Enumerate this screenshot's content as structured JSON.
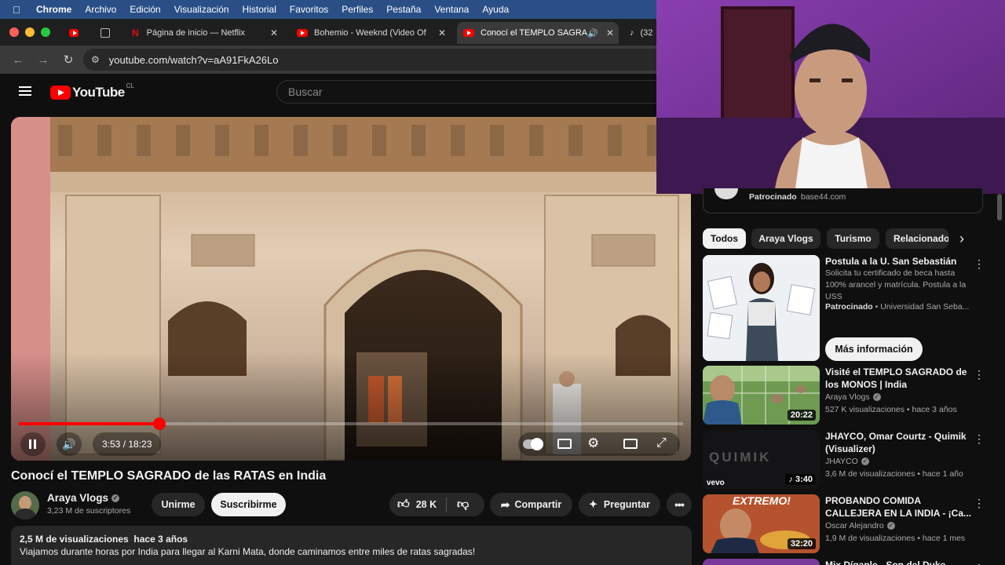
{
  "menubar": {
    "items": [
      "Chrome",
      "Archivo",
      "Edición",
      "Visualización",
      "Historial",
      "Favoritos",
      "Perfiles",
      "Pestaña",
      "Ventana",
      "Ayuda"
    ]
  },
  "tabs": [
    {
      "title": "Página de inicio — Netflix"
    },
    {
      "title": "Bohemio - Weeknd (Video Of"
    },
    {
      "title": "Conocí el TEMPLO SAGRA"
    },
    {
      "title": "(32"
    }
  ],
  "address": {
    "url": "youtube.com/watch?v=aA91FkA26Lo"
  },
  "youtube": {
    "logo_text": "YouTube",
    "country": "CL",
    "search_placeholder": "Buscar"
  },
  "player": {
    "time": "3:53 / 18:23",
    "progress": 0.211
  },
  "video": {
    "title": "Conocí el TEMPLO SAGRADO de las RATAS en India",
    "channel": "Araya Vlogs",
    "subscribers": "3,23 M de suscriptores",
    "join_label": "Unirme",
    "subscribe_label": "Suscribirme",
    "likes": "28 K",
    "share_label": "Compartir",
    "ask_label": "Preguntar",
    "views_date": "2,5 M de visualizaciones  hace 3 años",
    "description": "Viajamos durante horas por India para llegar al Karni Mata, donde caminamos entre miles de ratas sagradas!"
  },
  "sponsor_top": {
    "label": "Patrocinado",
    "domain": "base44.com"
  },
  "chips": [
    "Todos",
    "Araya Vlogs",
    "Turismo",
    "Relacionado"
  ],
  "ad": {
    "title": "Postula a la U. San Sebastián",
    "body": "Solicita tu certificado de beca hasta 100% arancel y matrícula. Postula a la USS",
    "sponsored": "Patrocinado",
    "advertiser": "Universidad San Seba...",
    "cta": "Más información"
  },
  "recommendations": [
    {
      "title_1": "Visité el TEMPLO SAGRADO de",
      "title_2": "los MONOS | India",
      "channel": "Araya Vlogs",
      "meta": "527 K visualizaciones • hace 3 años",
      "duration": "20:22"
    },
    {
      "title_1": "JHAYCO, Omar Courtz - Quimik",
      "title_2": "(Visualizer)",
      "channel": "JHAYCO",
      "meta": "3,6 M de visualizaciones • hace 1 año",
      "duration": "3:40",
      "thumb_text": "QUIMIK",
      "thumb_brand": "vevo"
    },
    {
      "title_1": "PROBANDO COMIDA",
      "title_2": "CALLEJERA EN LA INDIA - ¡Ca...",
      "channel": "Oscar Alejandro",
      "meta": "1,9 M de visualizaciones • hace 1 mes",
      "duration": "32:20",
      "thumb_text": "EXTREMO!"
    },
    {
      "title_1": "Mix Díganle - Son del Duke"
    }
  ],
  "colors": {
    "youtube_red": "#ff0000",
    "menubar_blue": "#2a4f86",
    "webcam_purple": "#7a2fa0"
  }
}
